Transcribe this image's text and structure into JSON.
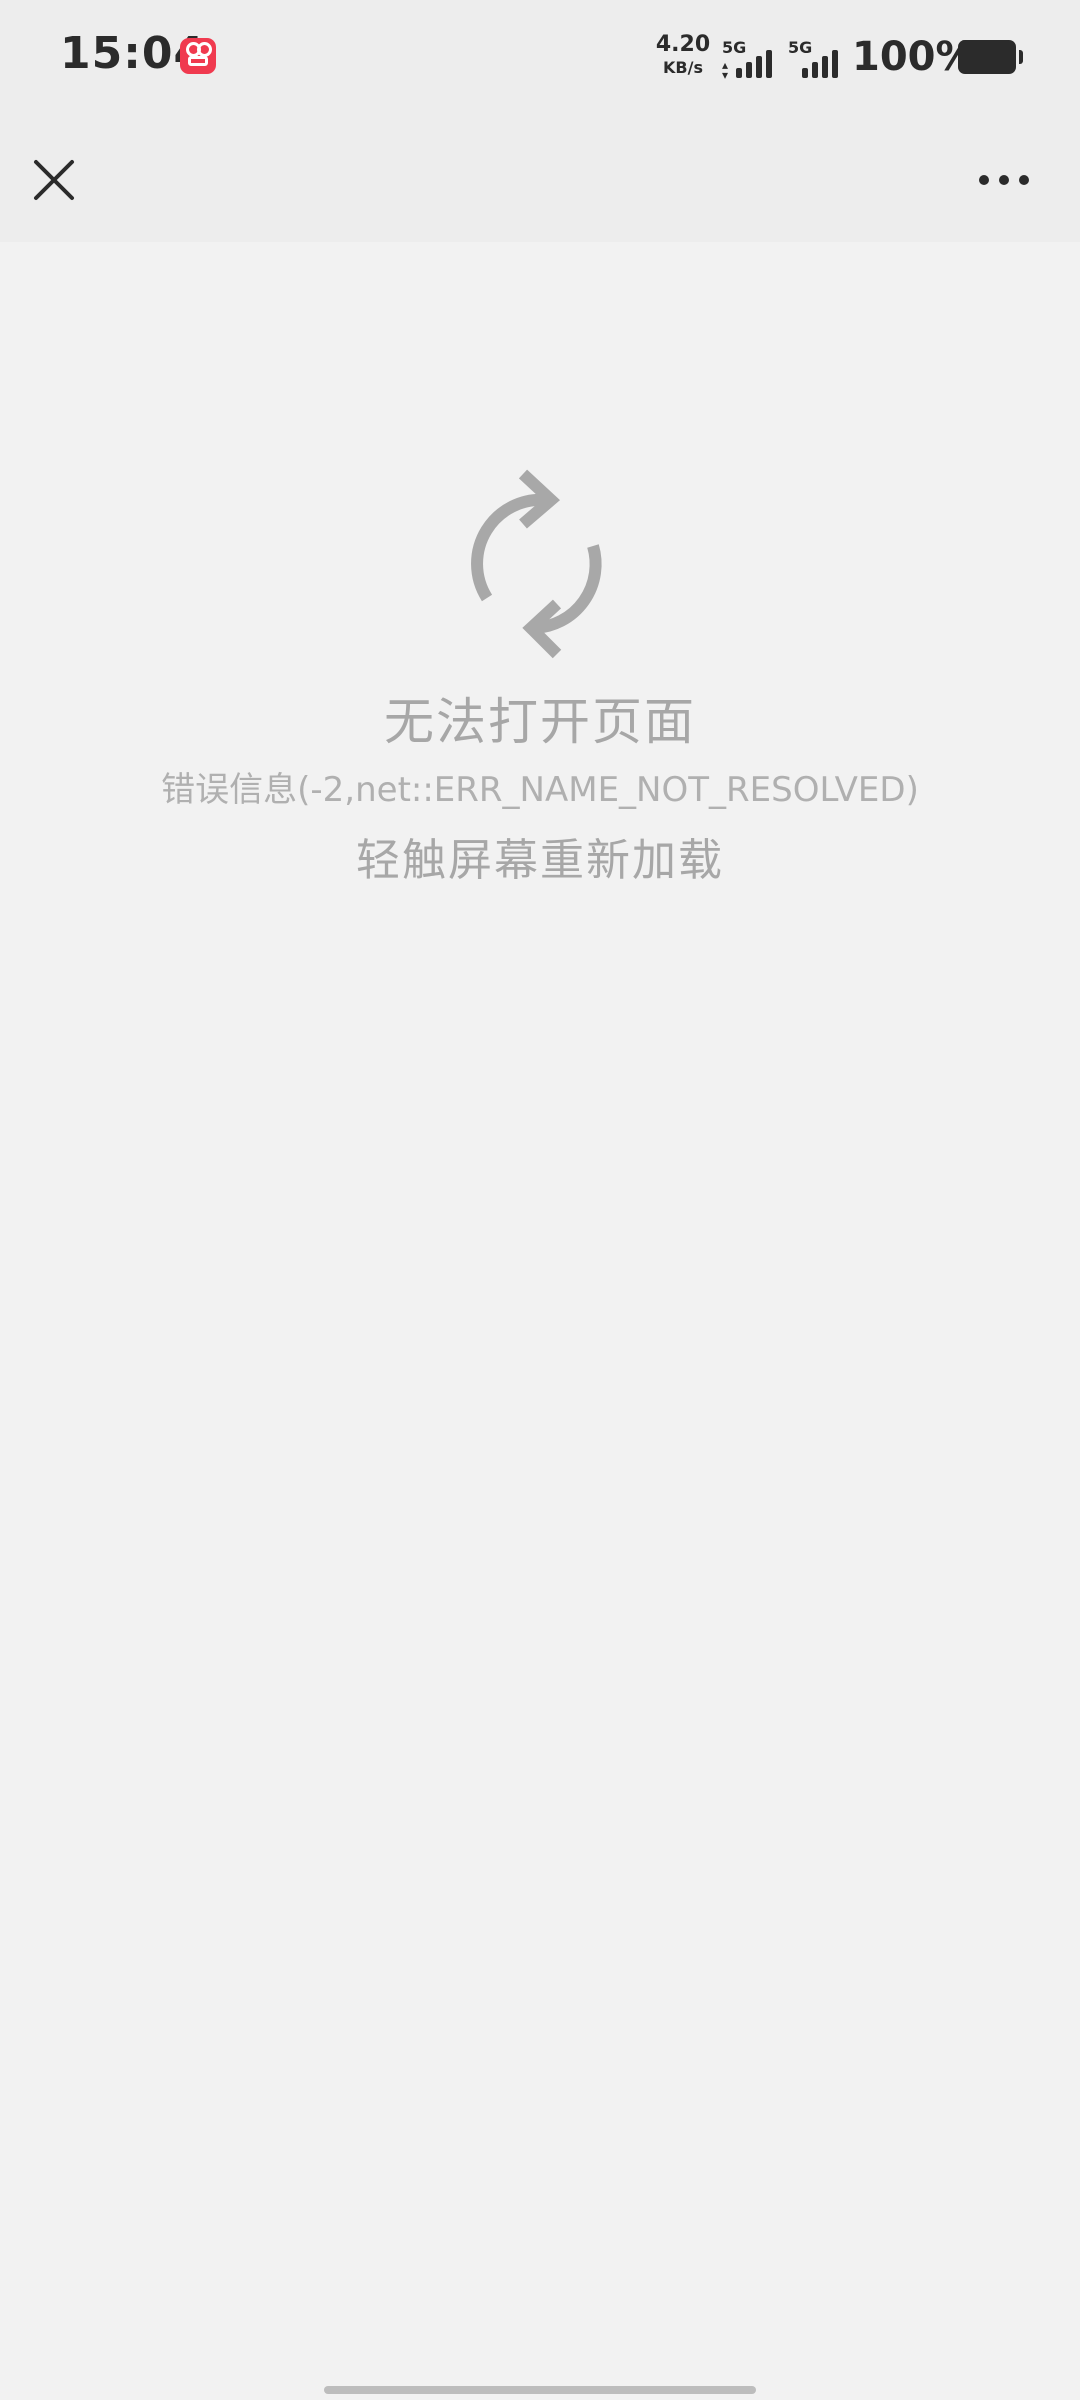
{
  "status_bar": {
    "time": "15:04",
    "app_icon": "app-notification-icon",
    "net_speed_value": "4.20",
    "net_speed_unit": "KB/s",
    "signal_1_label": "5G",
    "signal_2_label": "5G",
    "battery_percent": "100%"
  },
  "nav_bar": {
    "close_icon": "close-icon",
    "more_icon": "more-icon"
  },
  "error": {
    "icon": "refresh-icon",
    "title": "无法打开页面",
    "detail": "错误信息(-2,net::ERR_NAME_NOT_RESOLVED)",
    "hint": "轻触屏幕重新加载"
  },
  "colors": {
    "background": "#f2f2f2",
    "bar_background": "#ededed",
    "muted_text": "#a7a7a7",
    "icon_gray": "#a8a8a8",
    "app_badge": "#f03a4f"
  }
}
